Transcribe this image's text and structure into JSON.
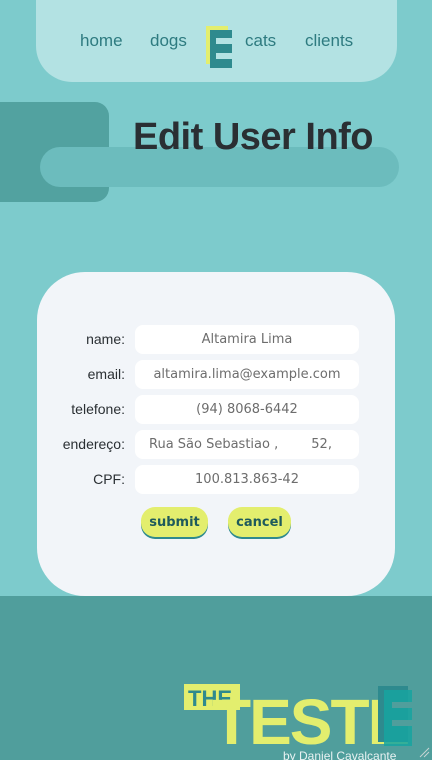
{
  "nav": {
    "items": [
      {
        "label": "home"
      },
      {
        "label": "dogs"
      },
      {
        "label": "cats"
      },
      {
        "label": "clients"
      }
    ],
    "logo_letter": "E"
  },
  "page": {
    "title": "Edit User Info"
  },
  "form": {
    "fields": [
      {
        "label": "name:",
        "value": "Altamira Lima"
      },
      {
        "label": "email:",
        "value": "altamira.lima@example.com"
      },
      {
        "label": "telefone:",
        "value": "(94) 8068-6442"
      },
      {
        "label": "endereço:",
        "value": "Rua São Sebastiao ,        52,"
      },
      {
        "label": "CPF:",
        "value": "100.813.863-42"
      }
    ],
    "submit_label": "submit",
    "cancel_label": "cancel"
  },
  "footer": {
    "logo_text": "THE TESTE",
    "credit": "by Daniel Cavalcante"
  },
  "colors": {
    "background": "#7dcbcc",
    "nav": "#b3e2e3",
    "accent_yellow": "#e3ee6e",
    "footer": "#509e9c",
    "card": "#f2f5f9"
  }
}
